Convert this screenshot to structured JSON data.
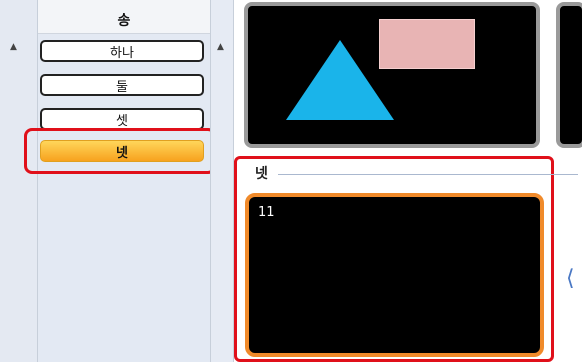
{
  "song_panel": {
    "title": "송",
    "items": [
      {
        "label": "하나",
        "active": false
      },
      {
        "label": "둘",
        "active": false
      },
      {
        "label": "셋",
        "active": false
      },
      {
        "label": "넷",
        "active": true
      }
    ]
  },
  "detail": {
    "section_label": "넷",
    "preview_number": "11"
  },
  "colors": {
    "highlight_red": "#e0101a",
    "active_orange": "#f7a21e",
    "triangle_blue": "#1ab4ea",
    "rect_pink": "#e8b4b4",
    "preview_border": "#f08a2a"
  }
}
